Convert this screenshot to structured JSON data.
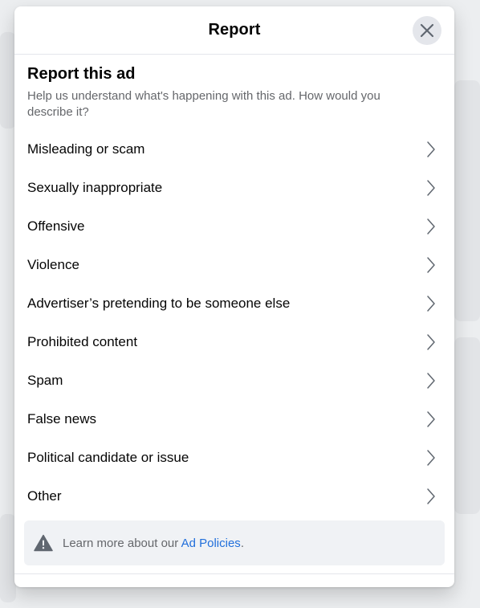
{
  "header": {
    "title": "Report",
    "close_icon": "close-icon"
  },
  "section": {
    "title": "Report this ad",
    "description": "Help us understand what's happening with this ad. How would you describe it?"
  },
  "options": [
    {
      "label": "Misleading or scam"
    },
    {
      "label": "Sexually inappropriate"
    },
    {
      "label": "Offensive"
    },
    {
      "label": "Violence"
    },
    {
      "label": "Advertiser’s pretending to be someone else"
    },
    {
      "label": "Prohibited content"
    },
    {
      "label": "Spam"
    },
    {
      "label": "False news"
    },
    {
      "label": "Political candidate or issue"
    },
    {
      "label": "Other"
    }
  ],
  "info": {
    "icon": "warning-icon",
    "text_prefix": "Learn more about our ",
    "link_text": "Ad Policies",
    "text_suffix": "."
  },
  "colors": {
    "link": "#216fdb",
    "secondary_text": "#65676b",
    "primary_text": "#050505"
  }
}
